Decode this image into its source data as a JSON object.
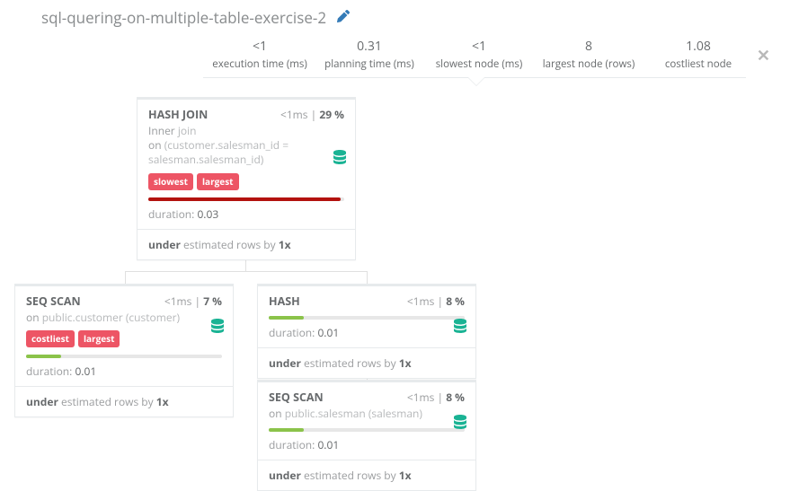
{
  "title": "sql-quering-on-multiple-table-exercise-2",
  "stats": [
    {
      "value": "<1",
      "label": "execution time (ms)"
    },
    {
      "value": "0.31",
      "label": "planning time (ms)"
    },
    {
      "value": "<1",
      "label": "slowest node (ms)"
    },
    {
      "value": "8",
      "label": "largest node (rows)"
    },
    {
      "value": "1.08",
      "label": "costliest node"
    }
  ],
  "nodes": {
    "top": {
      "name": "HASH JOIN",
      "time": "<1ms",
      "percent": "29 %",
      "sub_pre": "Inner ",
      "sub_light1": "join",
      "sub_mid": "on ",
      "sub_light2": "(customer.salesman_id = salesman.salesman_id)",
      "tags": [
        "slowest",
        "largest"
      ],
      "bar_pct": 98,
      "bar_color": "red",
      "dur_label": "duration: ",
      "dur_value": "0.03",
      "foot_b1": "under",
      "foot_mid": " estimated rows by ",
      "foot_b2": "1x"
    },
    "left": {
      "name": "SEQ SCAN",
      "time": "<1ms",
      "percent": "7 %",
      "sub_pre": "on ",
      "sub_light": "public.customer (customer)",
      "tags": [
        "costliest",
        "largest"
      ],
      "bar_pct": 18,
      "bar_color": "green",
      "dur_label": "duration: ",
      "dur_value": "0.01",
      "foot_b1": "under",
      "foot_mid": " estimated rows by ",
      "foot_b2": "1x"
    },
    "hash": {
      "name": "HASH",
      "time": "<1ms",
      "percent": "8 %",
      "bar_pct": 18,
      "bar_color": "green",
      "dur_label": "duration: ",
      "dur_value": "0.01",
      "foot_b1": "under",
      "foot_mid": " estimated rows by ",
      "foot_b2": "1x"
    },
    "bot": {
      "name": "SEQ SCAN",
      "time": "<1ms",
      "percent": "8 %",
      "sub_pre": "on ",
      "sub_light": "public.salesman (salesman)",
      "bar_pct": 18,
      "bar_color": "green",
      "dur_label": "duration: ",
      "dur_value": "0.01",
      "foot_b1": "under",
      "foot_mid": " estimated rows by ",
      "foot_b2": "1x"
    }
  }
}
